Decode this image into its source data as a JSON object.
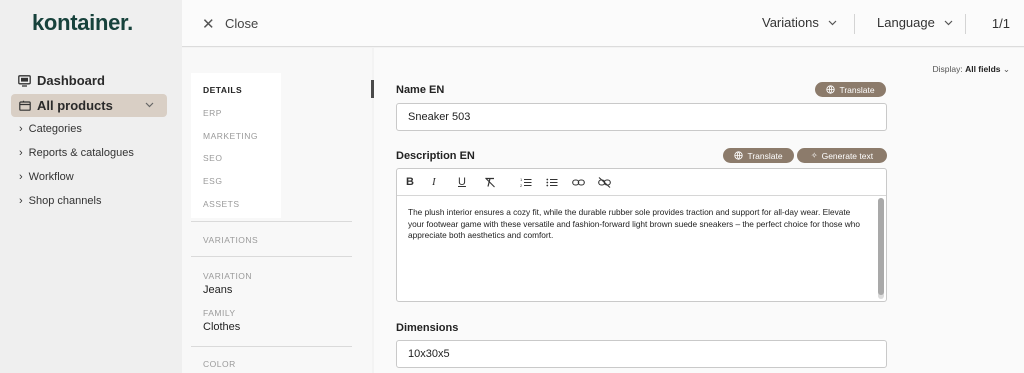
{
  "sidebar": {
    "logo": "kontainer.",
    "dashboard": "Dashboard",
    "active_item": "All products",
    "sub_items": [
      "Categories",
      "Reports & catalogues",
      "Workflow",
      "Shop channels"
    ]
  },
  "topbar": {
    "close_label": "Close",
    "variations_label": "Variations",
    "language_label": "Language",
    "pager": "1/1"
  },
  "tabs": [
    "DETAILS",
    "ERP",
    "MARKETING",
    "SEO",
    "ESG",
    "ASSETS"
  ],
  "side_info": {
    "variations_heading": "VARIATIONS",
    "variation_label": "VARIATION",
    "variation_value": "Jeans",
    "family_label": "FAMILY",
    "family_value": "Clothes",
    "color_label": "COLOR"
  },
  "main": {
    "display_prefix": "Display: ",
    "display_value": "All fields",
    "name_label": "Name EN",
    "name_value": "Sneaker 503",
    "translate_label": "Translate",
    "description_label": "Description EN",
    "generate_label": "Generate text",
    "description_text": "The plush interior ensures a cozy fit, while the durable rubber sole provides traction and support for all-day wear. Elevate your footwear game with these versatile and fashion-forward light brown suede sneakers – the perfect choice for those who appreciate both aesthetics and comfort.",
    "dimensions_label": "Dimensions",
    "dimensions_value": "10x30x5"
  },
  "colors": {
    "brand": "#17423c",
    "pill": "#8c7b6b",
    "active_nav": "#d9cfc5",
    "overlay": "rgba(0,0,0,0.06)"
  }
}
